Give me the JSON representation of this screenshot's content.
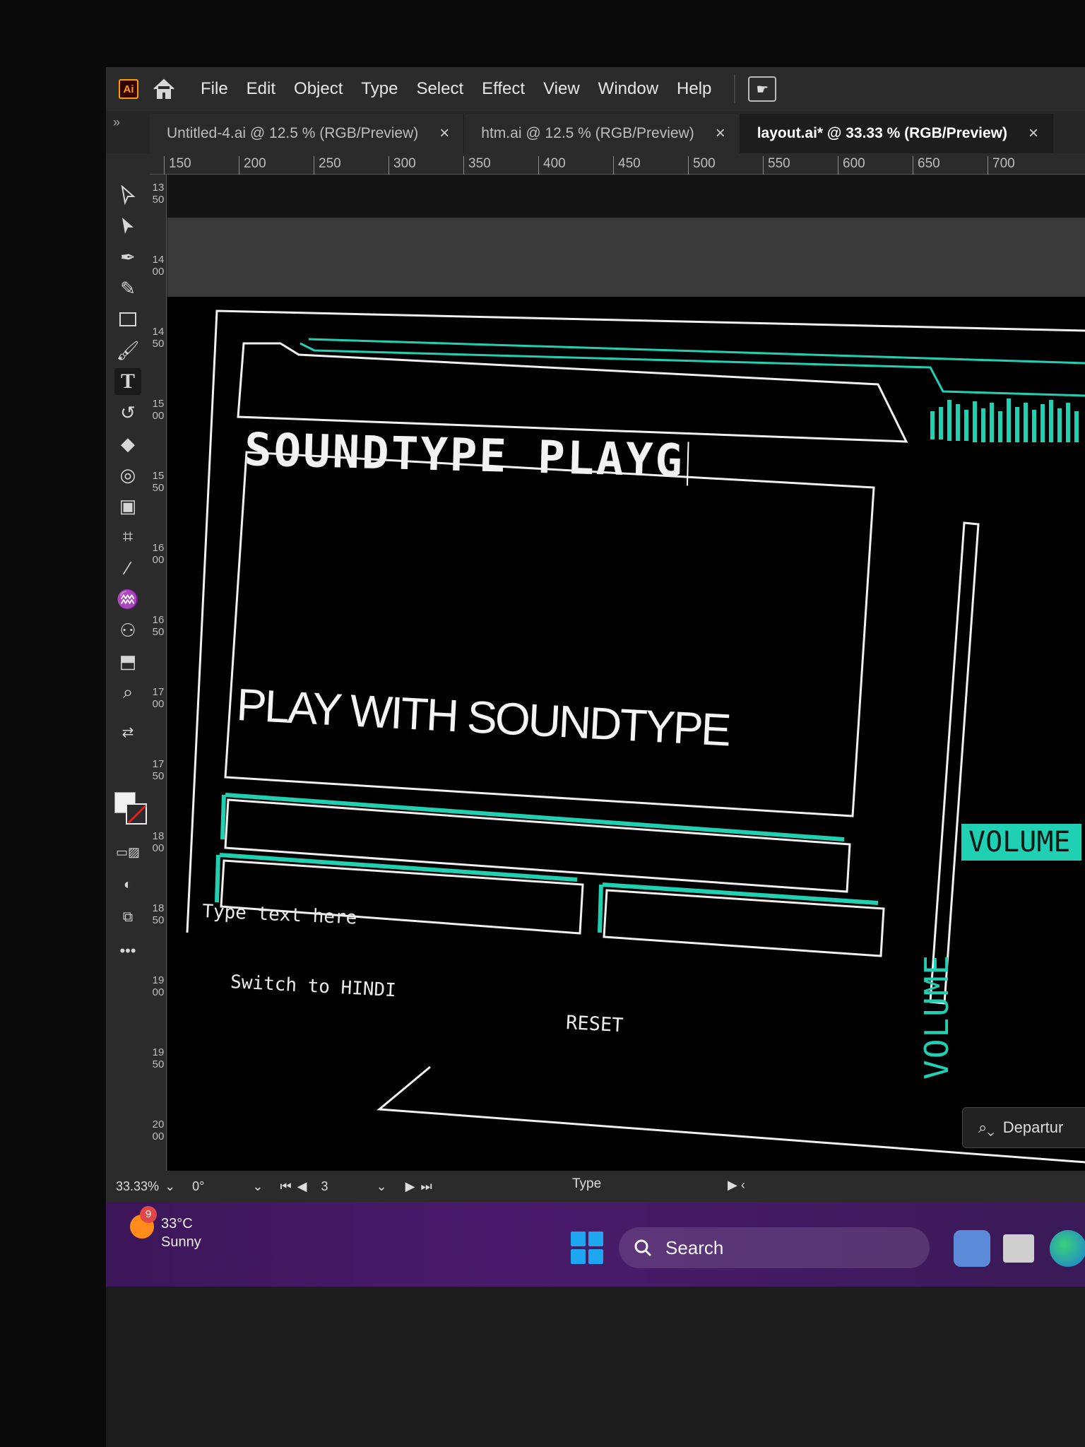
{
  "app": {
    "logo": "Ai",
    "menu": [
      "File",
      "Edit",
      "Object",
      "Type",
      "Select",
      "Effect",
      "View",
      "Window",
      "Help"
    ]
  },
  "tabs": [
    {
      "label": "Untitled-4.ai @ 12.5 % (RGB/Preview)",
      "active": false
    },
    {
      "label": "htm.ai @ 12.5 % (RGB/Preview)",
      "active": false
    },
    {
      "label": "layout.ai* @ 33.33 % (RGB/Preview)",
      "active": true
    }
  ],
  "tab_close": "×",
  "tab_gutter": "»",
  "ruler": {
    "top": [
      "150",
      "200",
      "250",
      "300",
      "350",
      "400",
      "450",
      "500",
      "550",
      "600",
      "650",
      "700"
    ],
    "left": [
      "1350",
      "1400",
      "1450",
      "1500",
      "1550",
      "1600",
      "1650",
      "1700",
      "1750",
      "1800",
      "1850",
      "1900",
      "1950",
      "2000"
    ]
  },
  "artwork": {
    "title": "SOUNDTYPE PLAYG",
    "display": "PLAY WITH SOUNDTYPE",
    "input_placeholder": "Type text here",
    "switch_button": "Switch to HINDI",
    "reset_button": "RESET",
    "volume_label": "VOLUME",
    "volume_vertical": "VOLUME",
    "accent": "#1fd1b2"
  },
  "float_search": {
    "text": "Departur"
  },
  "statusbar": {
    "zoom": "33.33%",
    "rotate": "0°",
    "artboard": "3",
    "tool": "Type"
  },
  "taskbar": {
    "weather_temp": "33°C",
    "weather_desc": "Sunny",
    "weather_badge": "9",
    "search": "Search"
  }
}
